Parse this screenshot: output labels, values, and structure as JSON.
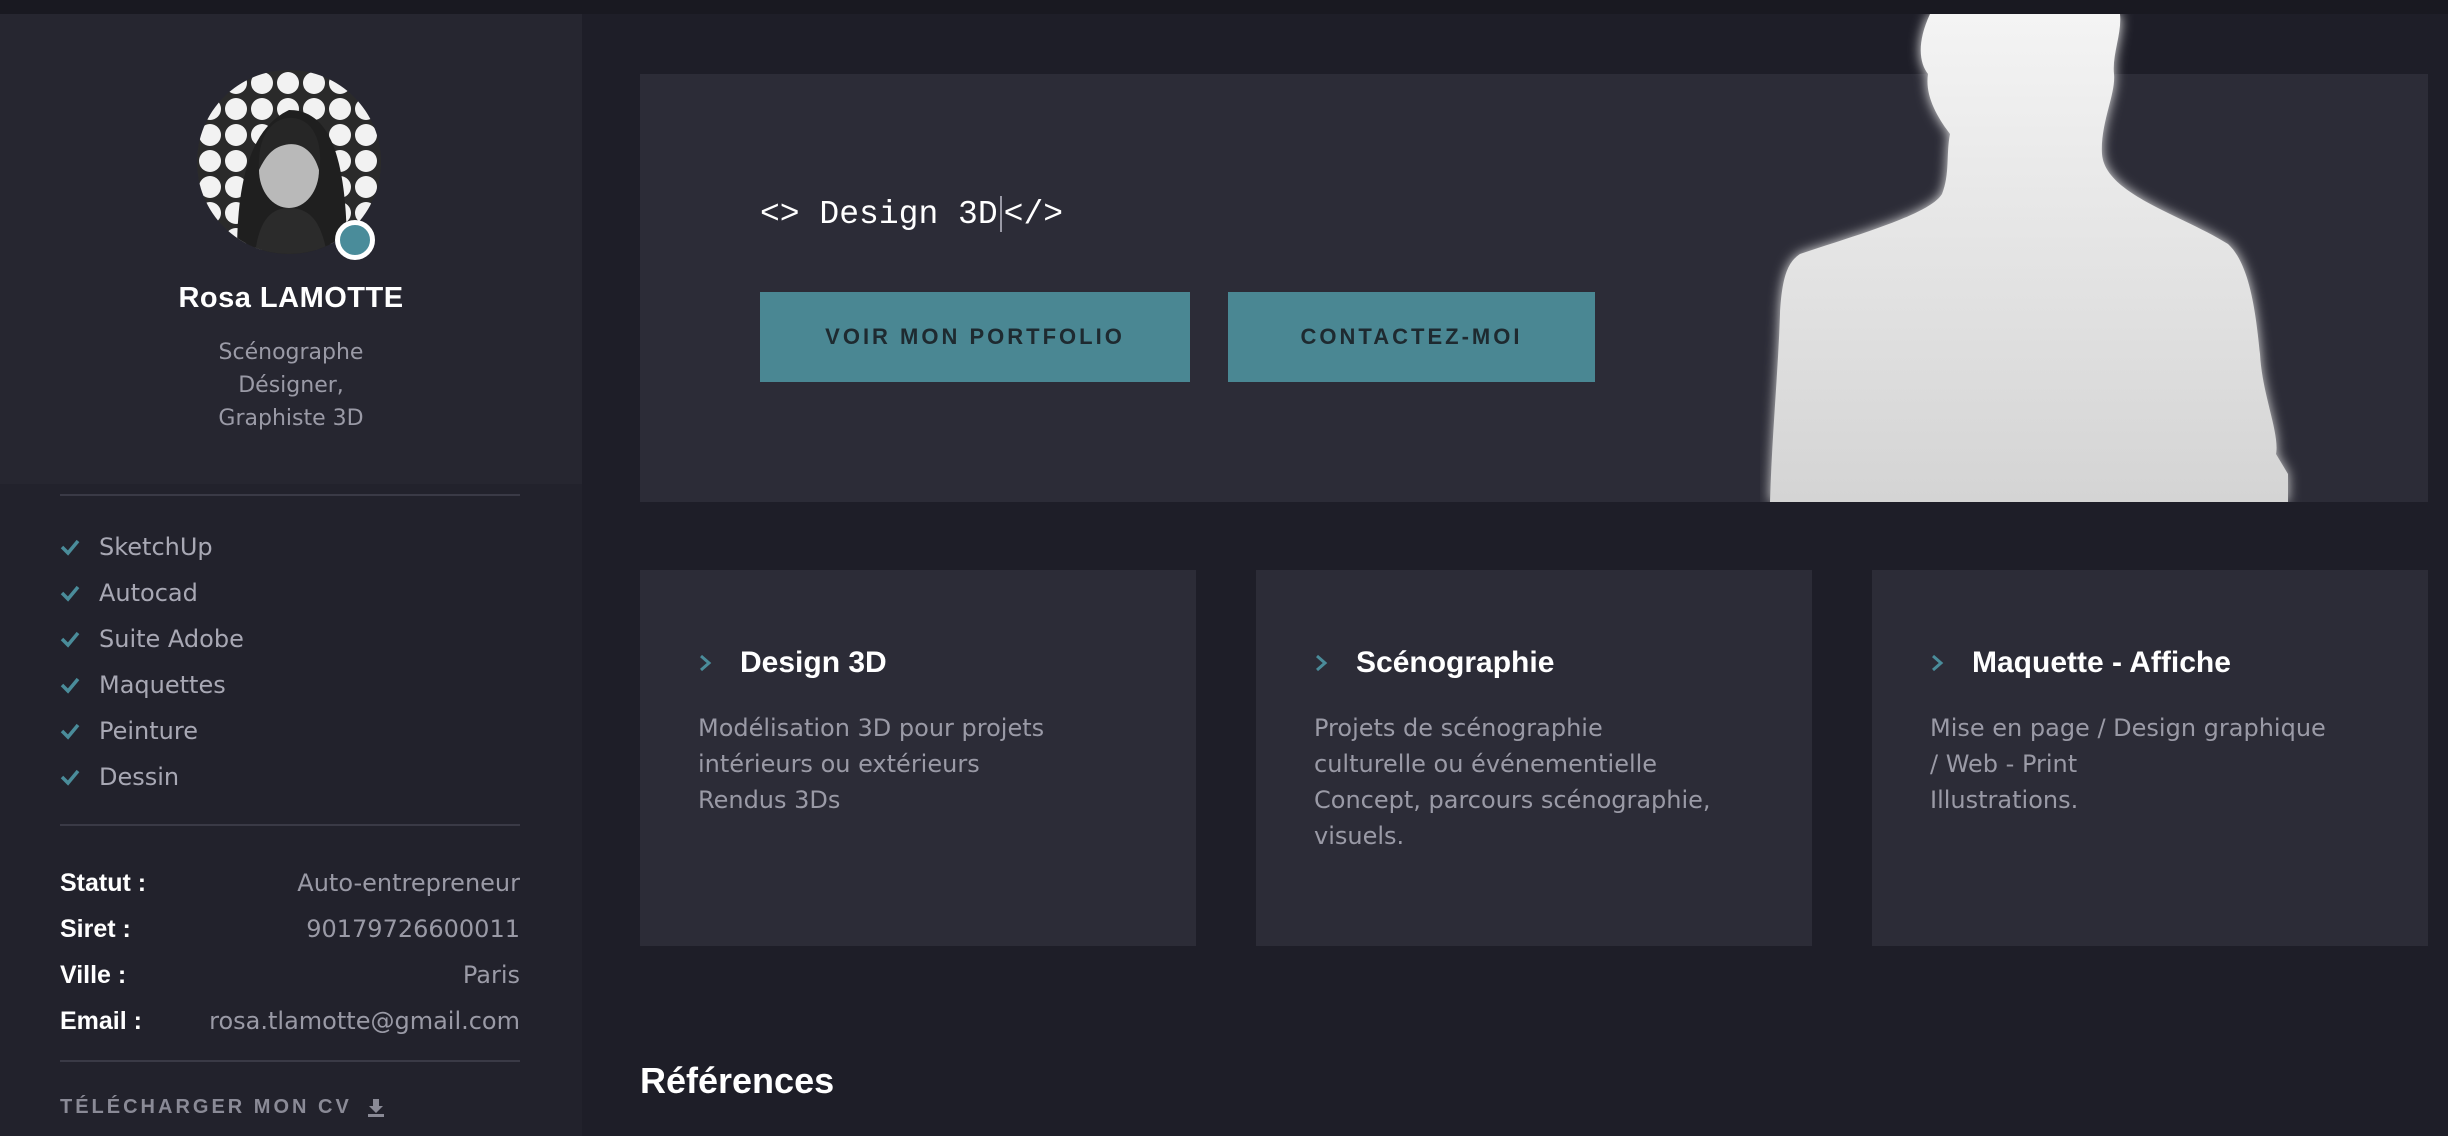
{
  "profile": {
    "name": "Rosa LAMOTTE",
    "roles": [
      "Scénographe",
      "Désigner,",
      "Graphiste 3D"
    ]
  },
  "skills": [
    "SketchUp",
    "Autocad",
    "Suite Adobe",
    "Maquettes",
    "Peinture",
    "Dessin"
  ],
  "info": [
    {
      "key": "Statut :",
      "value": "Auto-entrepreneur"
    },
    {
      "key": "Siret :",
      "value": "90179726600011"
    },
    {
      "key": "Ville :",
      "value": "Paris"
    },
    {
      "key": "Email :",
      "value": "rosa.tlamotte@gmail.com"
    }
  ],
  "cv_label": "TÉLÉCHARGER MON CV",
  "hero": {
    "open_tag": "<> ",
    "typed": "Design 3D",
    "close_tag": "</>",
    "portfolio_button": "VOIR MON PORTFOLIO",
    "contact_button": "CONTACTEZ-MOI"
  },
  "services": [
    {
      "title": "Design 3D",
      "text": "Modélisation 3D pour projets\nintérieurs ou extérieurs\nRendus 3Ds"
    },
    {
      "title": "Scénographie",
      "text": "Projets de scénographie\nculturelle ou événementielle\nConcept, parcours scénographie,\nvisuels."
    },
    {
      "title": "Maquette - Affiche",
      "text": "Mise en page / Design graphique\n/ Web - Print\nIllustrations."
    }
  ],
  "references_title": "Références",
  "colors": {
    "accent": "#4a8793",
    "background": "#1e1e28",
    "panel": "#2c2c37",
    "sidebar": "#22222c"
  },
  "icons": {
    "skill_bullet": "check-icon",
    "card_bullet": "chevron-right-icon",
    "cv": "download-icon"
  }
}
